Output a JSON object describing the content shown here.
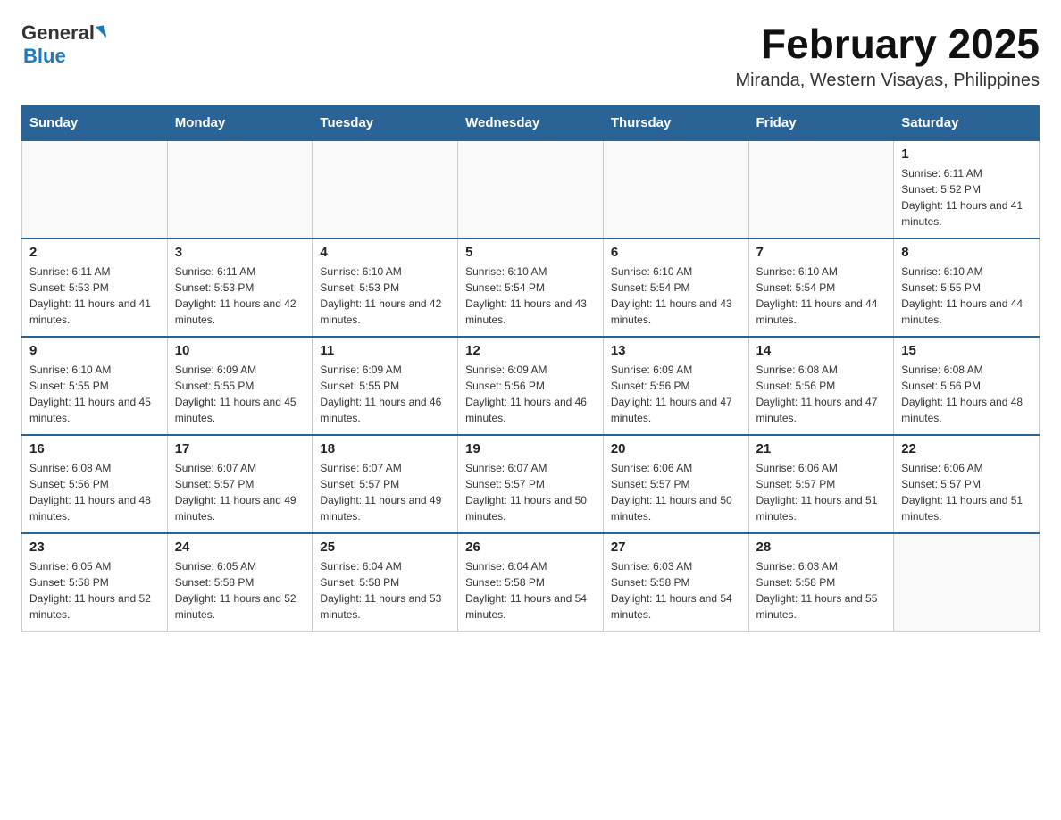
{
  "logo": {
    "general_text": "General",
    "blue_text": "Blue"
  },
  "header": {
    "month_title": "February 2025",
    "location": "Miranda, Western Visayas, Philippines"
  },
  "days_of_week": [
    "Sunday",
    "Monday",
    "Tuesday",
    "Wednesday",
    "Thursday",
    "Friday",
    "Saturday"
  ],
  "weeks": [
    {
      "days": [
        {
          "number": "",
          "info": ""
        },
        {
          "number": "",
          "info": ""
        },
        {
          "number": "",
          "info": ""
        },
        {
          "number": "",
          "info": ""
        },
        {
          "number": "",
          "info": ""
        },
        {
          "number": "",
          "info": ""
        },
        {
          "number": "1",
          "info": "Sunrise: 6:11 AM\nSunset: 5:52 PM\nDaylight: 11 hours and 41 minutes."
        }
      ]
    },
    {
      "days": [
        {
          "number": "2",
          "info": "Sunrise: 6:11 AM\nSunset: 5:53 PM\nDaylight: 11 hours and 41 minutes."
        },
        {
          "number": "3",
          "info": "Sunrise: 6:11 AM\nSunset: 5:53 PM\nDaylight: 11 hours and 42 minutes."
        },
        {
          "number": "4",
          "info": "Sunrise: 6:10 AM\nSunset: 5:53 PM\nDaylight: 11 hours and 42 minutes."
        },
        {
          "number": "5",
          "info": "Sunrise: 6:10 AM\nSunset: 5:54 PM\nDaylight: 11 hours and 43 minutes."
        },
        {
          "number": "6",
          "info": "Sunrise: 6:10 AM\nSunset: 5:54 PM\nDaylight: 11 hours and 43 minutes."
        },
        {
          "number": "7",
          "info": "Sunrise: 6:10 AM\nSunset: 5:54 PM\nDaylight: 11 hours and 44 minutes."
        },
        {
          "number": "8",
          "info": "Sunrise: 6:10 AM\nSunset: 5:55 PM\nDaylight: 11 hours and 44 minutes."
        }
      ]
    },
    {
      "days": [
        {
          "number": "9",
          "info": "Sunrise: 6:10 AM\nSunset: 5:55 PM\nDaylight: 11 hours and 45 minutes."
        },
        {
          "number": "10",
          "info": "Sunrise: 6:09 AM\nSunset: 5:55 PM\nDaylight: 11 hours and 45 minutes."
        },
        {
          "number": "11",
          "info": "Sunrise: 6:09 AM\nSunset: 5:55 PM\nDaylight: 11 hours and 46 minutes."
        },
        {
          "number": "12",
          "info": "Sunrise: 6:09 AM\nSunset: 5:56 PM\nDaylight: 11 hours and 46 minutes."
        },
        {
          "number": "13",
          "info": "Sunrise: 6:09 AM\nSunset: 5:56 PM\nDaylight: 11 hours and 47 minutes."
        },
        {
          "number": "14",
          "info": "Sunrise: 6:08 AM\nSunset: 5:56 PM\nDaylight: 11 hours and 47 minutes."
        },
        {
          "number": "15",
          "info": "Sunrise: 6:08 AM\nSunset: 5:56 PM\nDaylight: 11 hours and 48 minutes."
        }
      ]
    },
    {
      "days": [
        {
          "number": "16",
          "info": "Sunrise: 6:08 AM\nSunset: 5:56 PM\nDaylight: 11 hours and 48 minutes."
        },
        {
          "number": "17",
          "info": "Sunrise: 6:07 AM\nSunset: 5:57 PM\nDaylight: 11 hours and 49 minutes."
        },
        {
          "number": "18",
          "info": "Sunrise: 6:07 AM\nSunset: 5:57 PM\nDaylight: 11 hours and 49 minutes."
        },
        {
          "number": "19",
          "info": "Sunrise: 6:07 AM\nSunset: 5:57 PM\nDaylight: 11 hours and 50 minutes."
        },
        {
          "number": "20",
          "info": "Sunrise: 6:06 AM\nSunset: 5:57 PM\nDaylight: 11 hours and 50 minutes."
        },
        {
          "number": "21",
          "info": "Sunrise: 6:06 AM\nSunset: 5:57 PM\nDaylight: 11 hours and 51 minutes."
        },
        {
          "number": "22",
          "info": "Sunrise: 6:06 AM\nSunset: 5:57 PM\nDaylight: 11 hours and 51 minutes."
        }
      ]
    },
    {
      "days": [
        {
          "number": "23",
          "info": "Sunrise: 6:05 AM\nSunset: 5:58 PM\nDaylight: 11 hours and 52 minutes."
        },
        {
          "number": "24",
          "info": "Sunrise: 6:05 AM\nSunset: 5:58 PM\nDaylight: 11 hours and 52 minutes."
        },
        {
          "number": "25",
          "info": "Sunrise: 6:04 AM\nSunset: 5:58 PM\nDaylight: 11 hours and 53 minutes."
        },
        {
          "number": "26",
          "info": "Sunrise: 6:04 AM\nSunset: 5:58 PM\nDaylight: 11 hours and 54 minutes."
        },
        {
          "number": "27",
          "info": "Sunrise: 6:03 AM\nSunset: 5:58 PM\nDaylight: 11 hours and 54 minutes."
        },
        {
          "number": "28",
          "info": "Sunrise: 6:03 AM\nSunset: 5:58 PM\nDaylight: 11 hours and 55 minutes."
        },
        {
          "number": "",
          "info": ""
        }
      ]
    }
  ]
}
